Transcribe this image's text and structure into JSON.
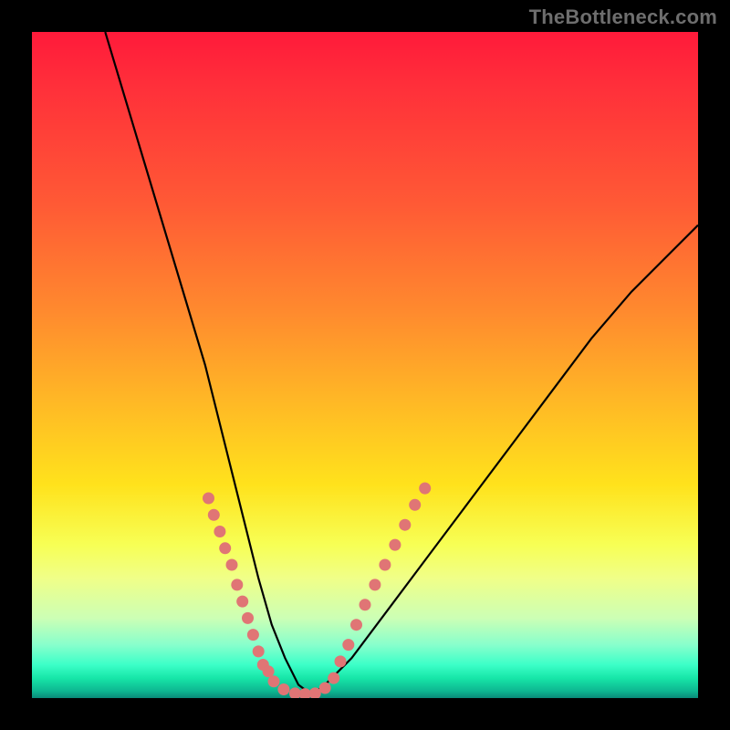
{
  "watermark": "TheBottleneck.com",
  "chart_data": {
    "type": "line",
    "title": "",
    "xlabel": "",
    "ylabel": "",
    "xlim": [
      0,
      100
    ],
    "ylim": [
      0,
      100
    ],
    "grid": false,
    "legend": false,
    "series": [
      {
        "name": "bottleneck-curve",
        "x": [
          11,
          14,
          17,
          20,
          23,
          26,
          28,
          30,
          32,
          34,
          36,
          38,
          40,
          42,
          44,
          48,
          54,
          60,
          66,
          72,
          78,
          84,
          90,
          96,
          100
        ],
        "y": [
          100,
          90,
          80,
          70,
          60,
          50,
          42,
          34,
          26,
          18,
          11,
          6,
          2,
          0.5,
          2,
          6,
          14,
          22,
          30,
          38,
          46,
          54,
          61,
          67,
          71
        ]
      }
    ],
    "markers": {
      "name": "highlight-dots",
      "x": [
        26.5,
        27.3,
        28.2,
        29.0,
        30.0,
        30.8,
        31.6,
        32.4,
        33.2,
        34.0,
        34.7,
        35.5,
        36.3,
        37.8,
        39.5,
        41.0,
        42.5,
        44.0,
        45.3,
        46.3,
        47.5,
        48.7,
        50.0,
        51.5,
        53.0,
        54.5,
        56.0,
        57.5,
        59.0
      ],
      "y": [
        30.0,
        27.5,
        25.0,
        22.5,
        20.0,
        17.0,
        14.5,
        12.0,
        9.5,
        7.0,
        5.0,
        4.0,
        2.5,
        1.3,
        0.7,
        0.6,
        0.7,
        1.5,
        3.0,
        5.5,
        8.0,
        11.0,
        14.0,
        17.0,
        20.0,
        23.0,
        26.0,
        29.0,
        31.5
      ]
    },
    "colors": {
      "curve": "#000000",
      "marker": "#e07575"
    }
  }
}
